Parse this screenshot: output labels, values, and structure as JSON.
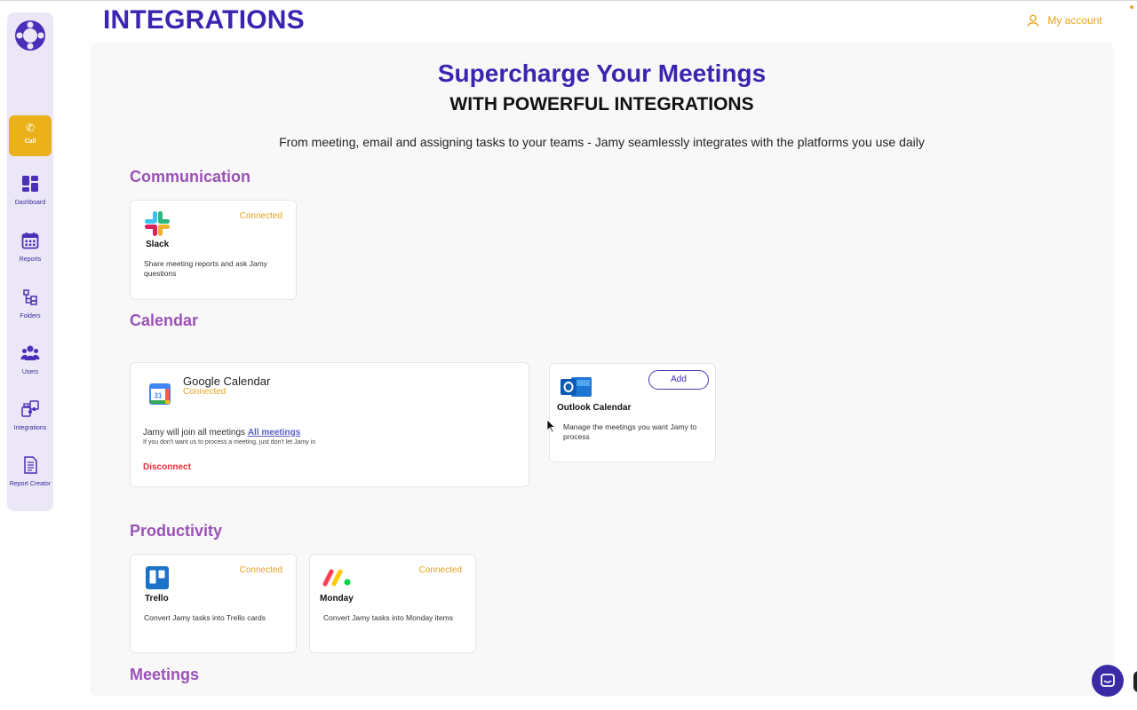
{
  "header": {
    "title": "INTEGRATIONS",
    "account_label": "My account"
  },
  "sidebar": {
    "call_label": "Call",
    "items": [
      {
        "label": "Dashboard",
        "icon": "dashboard-icon"
      },
      {
        "label": "Reports",
        "icon": "calendar-report-icon"
      },
      {
        "label": "Folders",
        "icon": "folders-icon"
      },
      {
        "label": "Users",
        "icon": "users-icon"
      },
      {
        "label": "Integrations",
        "icon": "puzzle-icon"
      },
      {
        "label": "Report Creator",
        "icon": "document-icon"
      }
    ]
  },
  "hero": {
    "title": "Supercharge Your Meetings",
    "subtitle": "WITH POWERFUL INTEGRATIONS",
    "description": "From meeting, email and assigning tasks to your teams - Jamy seamlessly integrates with the platforms you use daily"
  },
  "sections": {
    "communication": "Communication",
    "calendar": "Calendar",
    "productivity": "Productivity",
    "meetings": "Meetings"
  },
  "slack": {
    "name": "Slack",
    "status": "Connected",
    "description": "Share meeting reports and ask Jamy questions"
  },
  "google_calendar": {
    "name": "Google Calendar",
    "status": "Connected",
    "join_text": "Jamy will join all meetings",
    "join_link": "All meetings",
    "note": "If you don't want us to process a meeting, just don't let Jamy in",
    "disconnect_label": "Disconnect"
  },
  "outlook": {
    "name": "Outlook Calendar",
    "add_label": "Add",
    "description": "Manage the meetings you want Jamy to process"
  },
  "trello": {
    "name": "Trello",
    "status": "Connected",
    "description": "Convert Jamy tasks into Trello cards"
  },
  "monday": {
    "name": "Monday",
    "status": "Connected",
    "description": "Convert Jamy tasks into Monday items"
  },
  "colors": {
    "brand_purple": "#3d24b0",
    "section_purple": "#9a52b8",
    "accent_yellow": "#eab11a",
    "status_orange": "#e6a21d",
    "danger_red": "#e8303a"
  }
}
